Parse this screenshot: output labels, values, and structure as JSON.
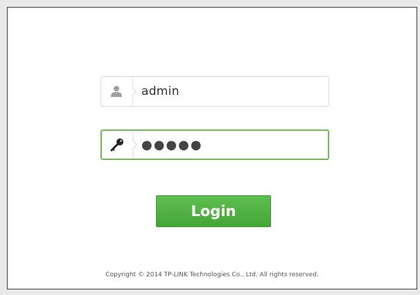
{
  "login_form": {
    "username_value": "admin",
    "password_masked": "●●●●●",
    "login_label": "Login"
  },
  "footer": {
    "copyright": "Copyright © 2014 TP-LINK Technologies Co., Ltd. All rights reserved."
  },
  "icons": {
    "username": "user-icon",
    "password": "key-icon"
  },
  "colors": {
    "accent_green": "#4cae3c",
    "focus_border": "#6cbf4d"
  }
}
